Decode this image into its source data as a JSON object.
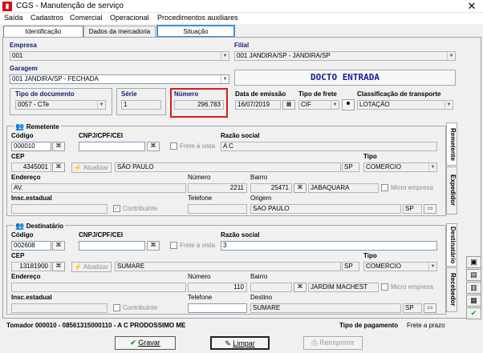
{
  "window": {
    "title": "CGS - Manutenção de serviço",
    "close": "✕",
    "app_icon": "cgs-app-icon"
  },
  "menu": [
    "Saída",
    "Cadastros",
    "Comercial",
    "Operacional",
    "Procedimentos auxiliares"
  ],
  "tabs": [
    "Identificação",
    "Dados da mercadoria",
    "Situação"
  ],
  "empresa": {
    "label": "Empresa",
    "value": "001"
  },
  "filial": {
    "label": "Filial",
    "value": "001 JANDIRA/SP - JANDIRA/SP"
  },
  "garagem": {
    "label": "Garagem",
    "value": "001 JANDIRA/SP - FECHADA"
  },
  "docto_entrada": "DOCTO ENTRADA",
  "tipo_documento": {
    "label": "Tipo de documento",
    "value": "0057 - CTe"
  },
  "serie": {
    "label": "Série",
    "value": "1"
  },
  "numero": {
    "label": "Número",
    "value": "296.783"
  },
  "data_emissao": {
    "label": "Data de emissão",
    "value": "16/07/2019"
  },
  "tipo_frete": {
    "label": "Tipo de frete",
    "value": "CIF"
  },
  "classificacao": {
    "label": "Classificação de transporte",
    "value": "LOTAÇÃO"
  },
  "remetente": {
    "title": "Remetente",
    "codigo_label": "Código",
    "codigo": "000010",
    "cnpj_label": "CNPJ/CPF/CEI",
    "frete_vista": "Frete à vista",
    "razao_label": "Razão social",
    "razao": "A C",
    "cep_label": "CEP",
    "cep": "4345001",
    "atualizar": "Atualizar",
    "cidade": "SÃO PAULO",
    "uf": "SP",
    "tipo_label": "Tipo",
    "tipo": "COMERCIO",
    "endereco_label": "Endereço",
    "endereco": "AV.",
    "numero_label": "Número",
    "numero": "2211",
    "bairro_label": "Bairro",
    "bairro_cod": "25471",
    "bairro": "JABAQUARA",
    "micro": "Micro empresa",
    "insc_label": "Insc.estadual",
    "contribuinte": "Contribuinte",
    "telefone_label": "Telefone",
    "origem_label": "Origem",
    "origem": "SAO PAULO",
    "origem_uf": "SP"
  },
  "destinatario": {
    "title": "Destinatário",
    "codigo_label": "Código",
    "codigo": "002608",
    "cnpj_label": "CNPJ/CPF/CEI",
    "frete_vista": "Frete à vista",
    "razao_label": "Razão social",
    "razao": "3",
    "cep_label": "CEP",
    "cep": "13181900",
    "atualizar": "Atualizar",
    "cidade": "SUMARE",
    "uf": "SP",
    "tipo_label": "Tipo",
    "tipo": "COMERCIO",
    "endereco_label": "Endereço",
    "numero_label": "Número",
    "numero": "110",
    "bairro_label": "Bairro",
    "bairro": "JARDIM MACHEST",
    "micro": "Micro empresa",
    "insc_label": "Insc.estadual",
    "contribuinte": "Contribuinte",
    "telefone_label": "Telefone",
    "destino_label": "Destino",
    "destino": "SUMARE",
    "destino_uf": "SP"
  },
  "side_tabs": [
    "Remetente",
    "Expedidor",
    "Destinatário",
    "Recebedor"
  ],
  "tomador": "Tomador 000010 - 08561315000110 - A C PRODOSSIMO ME",
  "tipo_pagamento_label": "Tipo de pagamento",
  "tipo_pagamento": "Frete a prazo",
  "buttons": {
    "gravar": "Gravar",
    "limpar": "Limpar",
    "reimprimir": "Reimprimir"
  }
}
